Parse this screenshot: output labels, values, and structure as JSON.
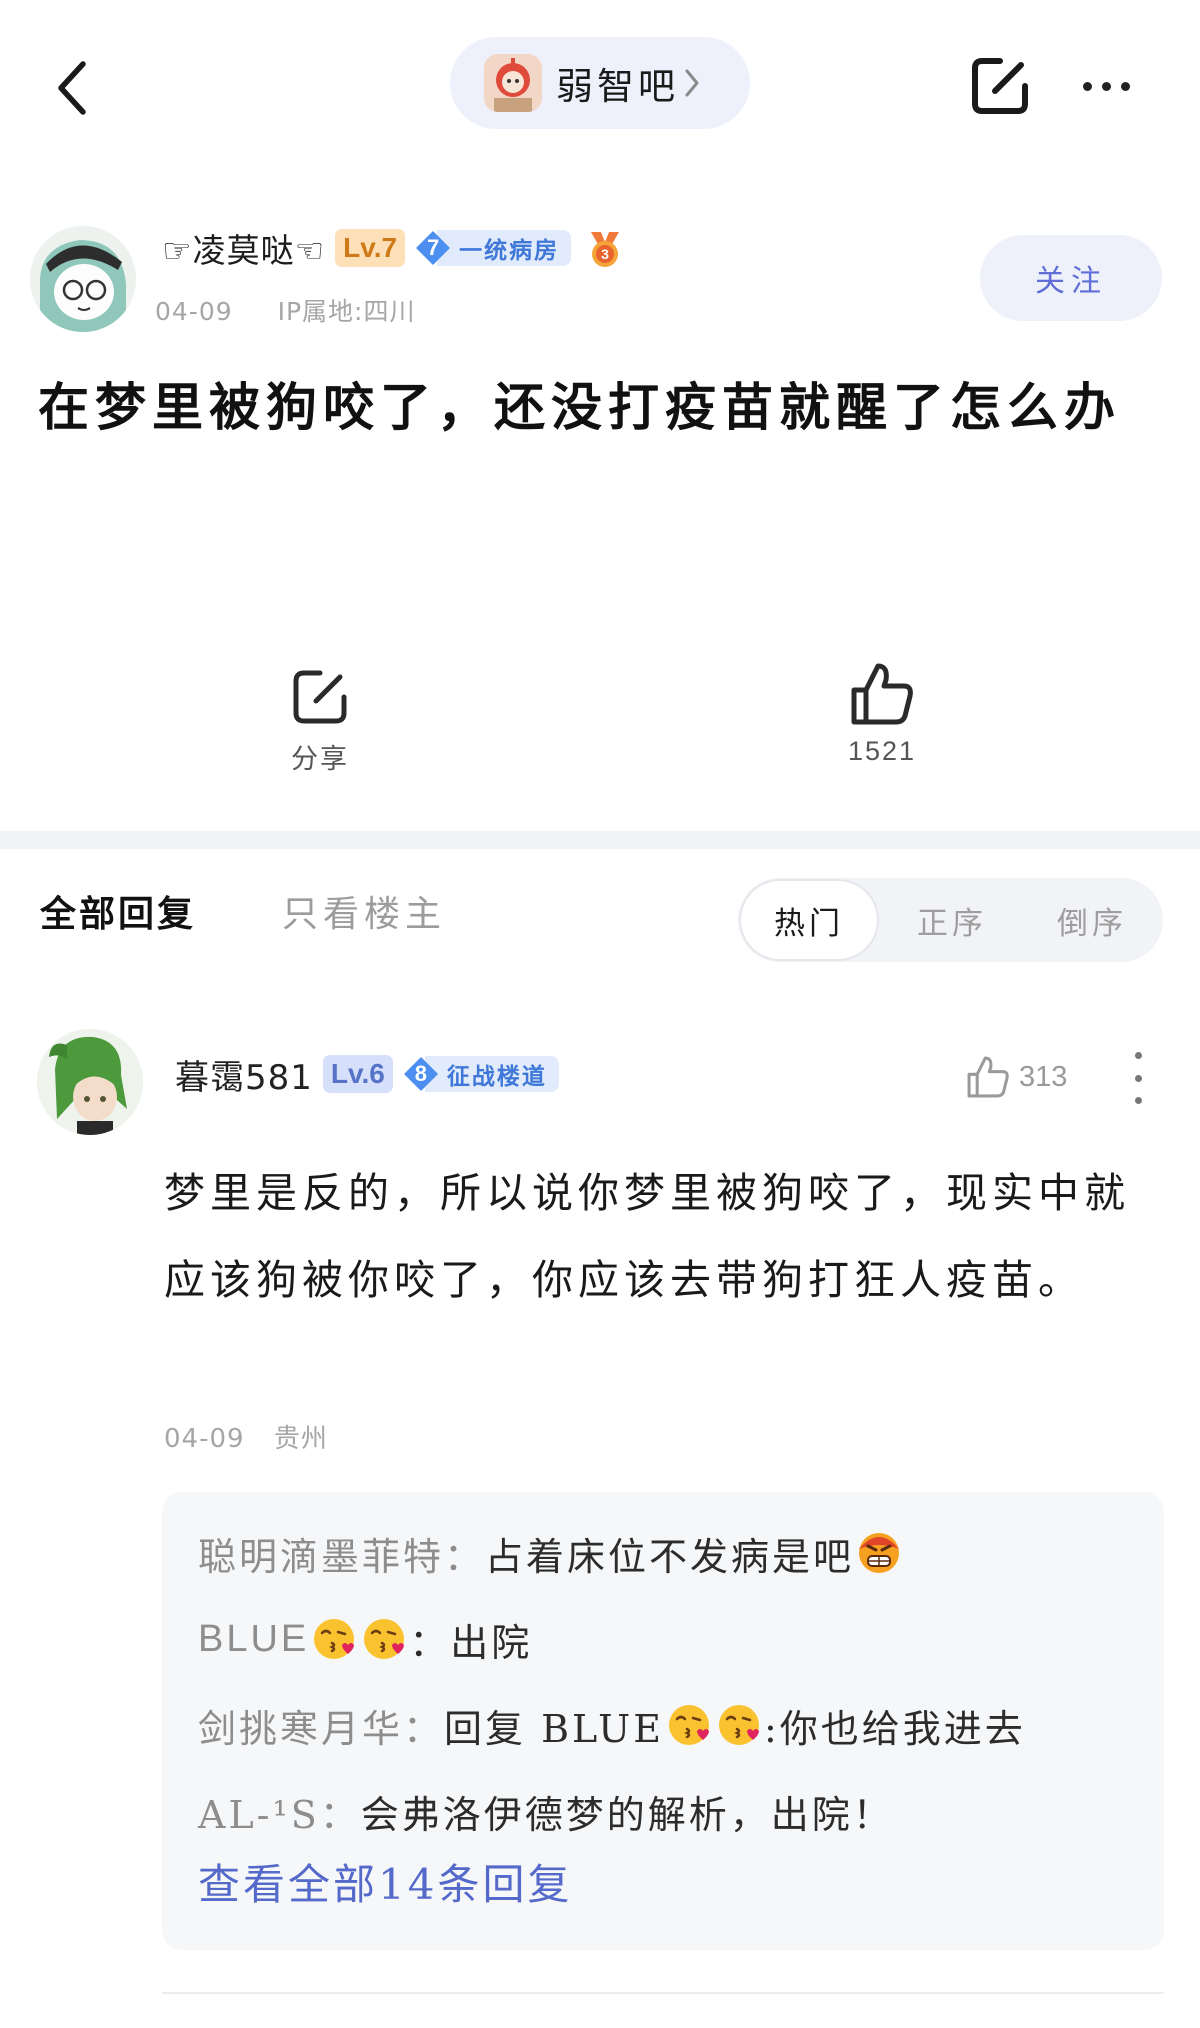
{
  "topbar": {
    "forum_name": "弱智吧"
  },
  "author": {
    "name": "☞凌莫哒☜",
    "level": "Lv.7",
    "bar_level": "7",
    "bar_title": "一统病房",
    "date": "04-09",
    "ip": "IP属地:四川",
    "follow_label": "关注"
  },
  "post": {
    "title": "在梦里被狗咬了，还没打疫苗就醒了怎么办"
  },
  "actions": {
    "share_label": "分享",
    "like_count": "1521"
  },
  "tabs": {
    "all_replies": "全部回复",
    "only_op": "只看楼主",
    "sort_options": [
      "热门",
      "正序",
      "倒序"
    ],
    "active_sort": "热门"
  },
  "comment": {
    "username": "暮霭581",
    "level": "Lv.6",
    "bar_level": "8",
    "bar_title": "征战楼道",
    "like_count": "313",
    "body": "梦里是反的，所以说你梦里被狗咬了，现实中就应该狗被你咬了，你应该去带狗打狂人疫苗。",
    "date": "04-09",
    "location": "贵州",
    "replies": [
      {
        "user": "聪明滴墨菲特：",
        "text": "占着床位不发病是吧"
      },
      {
        "user": "BLUE",
        "text": "：出院"
      },
      {
        "user": "剑挑寒月华：",
        "text": "回复 BLUE",
        "tail": ":你也给我进去"
      },
      {
        "user": "AL-¹S：",
        "text": "会弗洛伊德梦的解析，出院！"
      }
    ],
    "view_all": "查看全部14条回复"
  },
  "colors": {
    "accent": "#5469c9",
    "follow_bg": "#eef0fa",
    "level_orange": "#cf7a19",
    "bar_badge_blue": "#3f78d8"
  },
  "icons": [
    "back-icon",
    "chevron-right-icon",
    "edit-icon",
    "more-icon",
    "share-icon",
    "thumbs-up-icon",
    "kiss-emoji-icon",
    "angry-emoji-icon",
    "medal-icon"
  ]
}
